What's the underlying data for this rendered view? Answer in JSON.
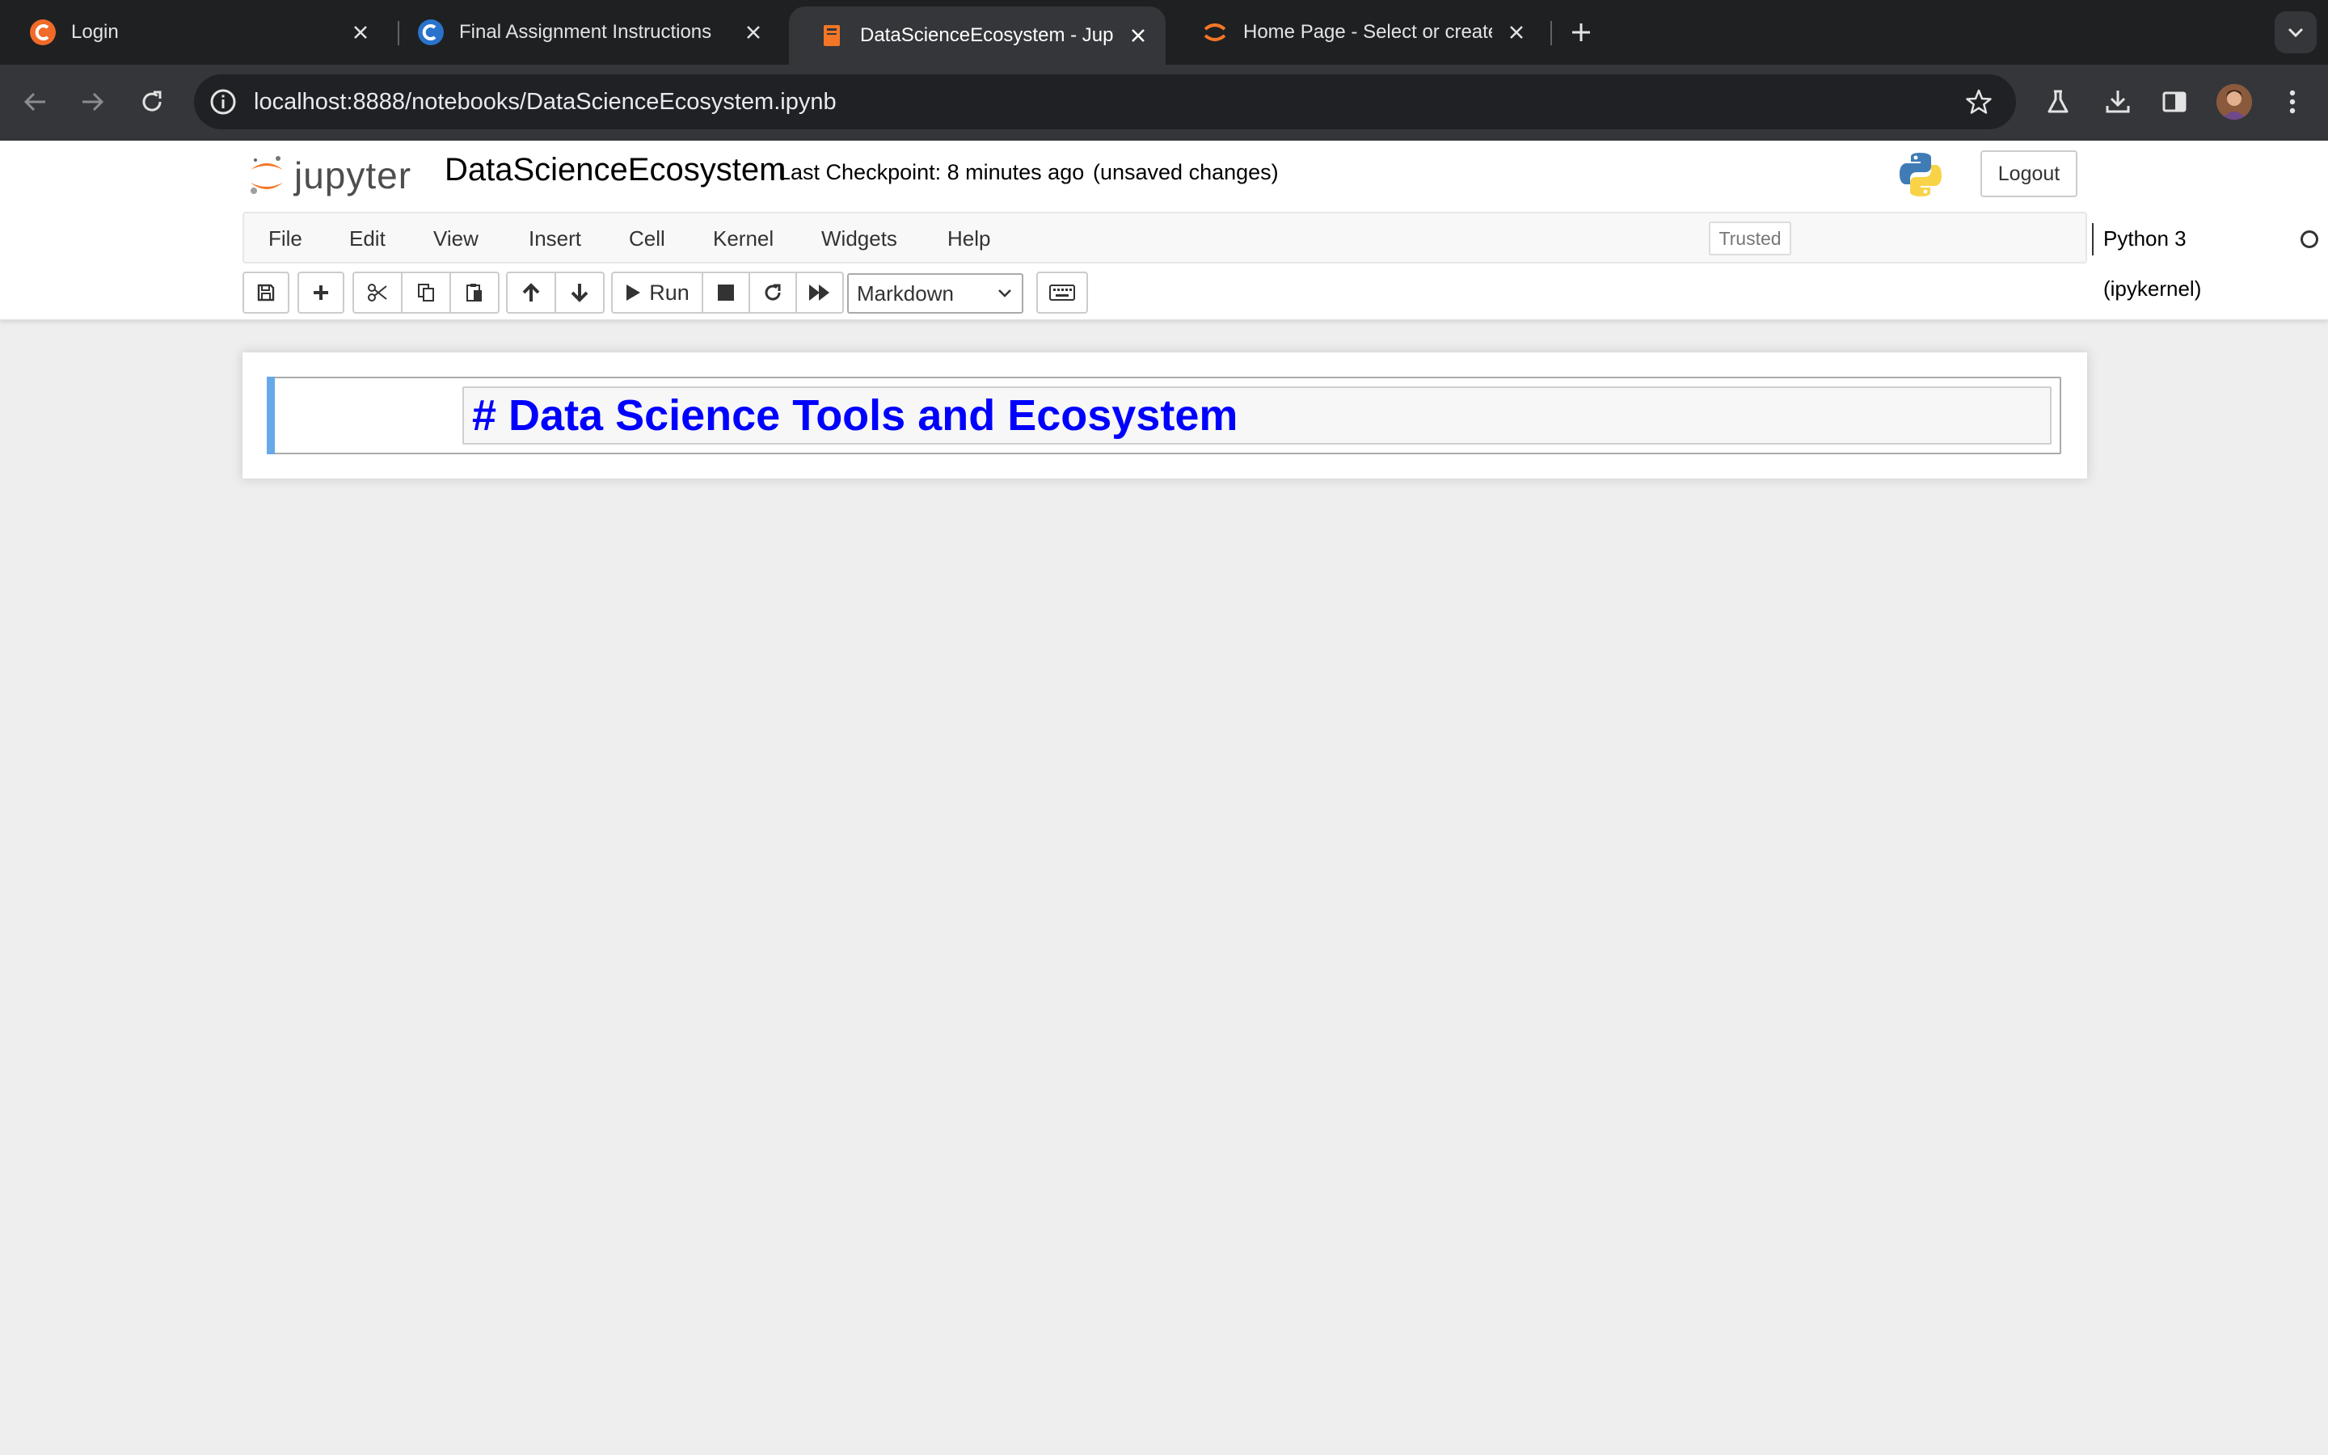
{
  "browser": {
    "tabs": [
      {
        "title": "Login",
        "icon": "coursera-icon",
        "active": false
      },
      {
        "title": "Final Assignment Instructions",
        "icon": "coursera-c-icon",
        "active": false
      },
      {
        "title": "DataScienceEcosystem - Jupyter Notebook",
        "icon": "notebook-icon",
        "active": true
      },
      {
        "title": "Home Page - Select or create a notebook",
        "icon": "jupyter-icon",
        "active": false
      }
    ],
    "url": "localhost:8888/notebooks/DataScienceEcosystem.ipynb"
  },
  "jupyter": {
    "logo_text": "jupyter",
    "notebook_name": "DataScienceEcosystem",
    "checkpoint": "Last Checkpoint: 8 minutes ago",
    "unsaved": "(unsaved changes)",
    "logout_label": "Logout",
    "menu": [
      "File",
      "Edit",
      "View",
      "Insert",
      "Cell",
      "Kernel",
      "Widgets",
      "Help"
    ],
    "trusted_label": "Trusted",
    "kernel_name": "Python 3 (ipykernel)",
    "run_label": "Run",
    "cell_type": "Markdown",
    "cell_source": "# Data Science Tools and Ecosystem"
  },
  "colors": {
    "chrome_tabstrip": "#1f2022",
    "chrome_toolbar": "#35363a",
    "cell_accent": "#66a9e8",
    "markdown_heading": "#0000ff"
  }
}
